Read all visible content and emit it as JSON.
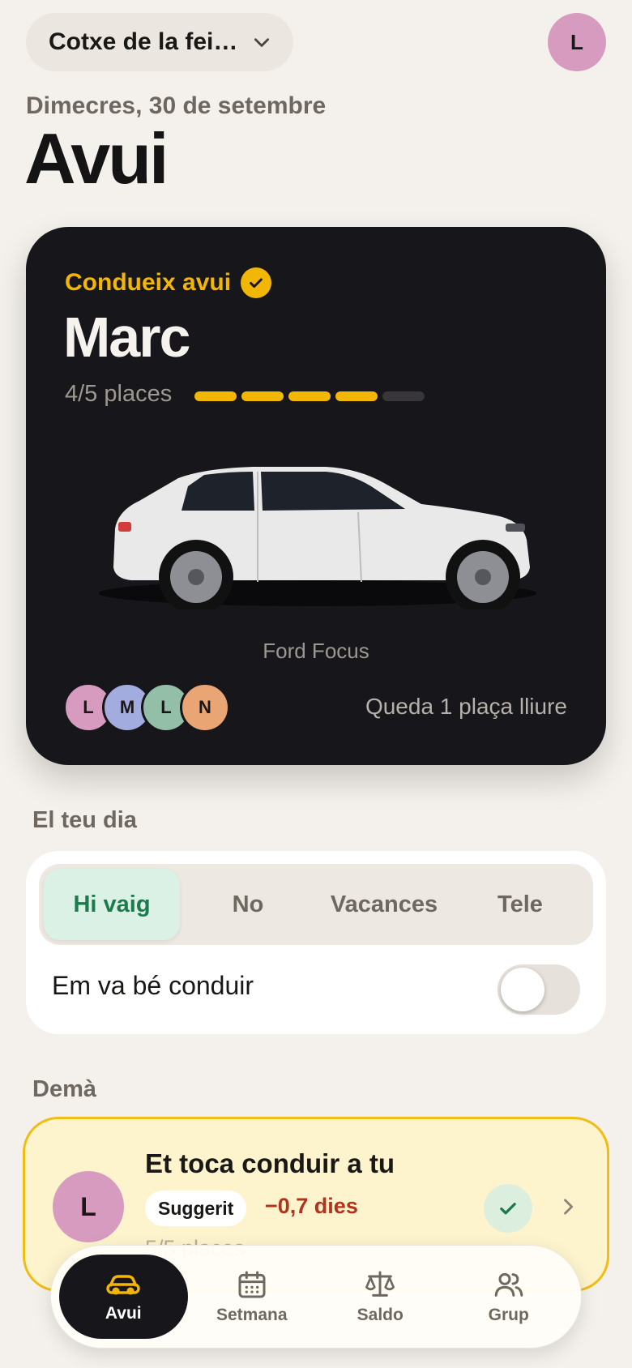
{
  "header": {
    "group_name": "Cotxe de la fei…",
    "user_initial": "L",
    "date": "Dimecres, 30 de setembre",
    "title": "Avui"
  },
  "driver_card": {
    "label": "Condueix avui",
    "driver": "Marc",
    "seats_text": "4/5 places",
    "seats_taken": 4,
    "seats_total": 5,
    "car_model": "Ford Focus",
    "riders": [
      {
        "initial": "L",
        "color": "#d79bbf"
      },
      {
        "initial": "M",
        "color": "#a3acde"
      },
      {
        "initial": "L",
        "color": "#93bfa9"
      },
      {
        "initial": "N",
        "color": "#eaa574"
      }
    ],
    "free_seats_text": "Queda 1 plaça lliure"
  },
  "your_day": {
    "section_label": "El teu dia",
    "options": [
      "Hi vaig",
      "No",
      "Vacances",
      "Tele"
    ],
    "selected": "Hi vaig",
    "toggle_label": "Em va bé conduir",
    "toggle_on": false
  },
  "tomorrow": {
    "section_label": "Demà",
    "initial": "L",
    "title": "Et toca conduir a tu",
    "chip": "Suggerit",
    "balance": "−0,7 dies",
    "seats_text": "5/5 places"
  },
  "tabs": [
    {
      "label": "Avui",
      "icon": "car-icon",
      "active": true
    },
    {
      "label": "Setmana",
      "icon": "calendar-icon",
      "active": false
    },
    {
      "label": "Saldo",
      "icon": "scale-icon",
      "active": false
    },
    {
      "label": "Grup",
      "icon": "users-icon",
      "active": false
    }
  ],
  "colors": {
    "accent": "#f2b705",
    "card_dark": "#17161a",
    "success": "#1c7a4c",
    "danger": "#b2321c"
  }
}
